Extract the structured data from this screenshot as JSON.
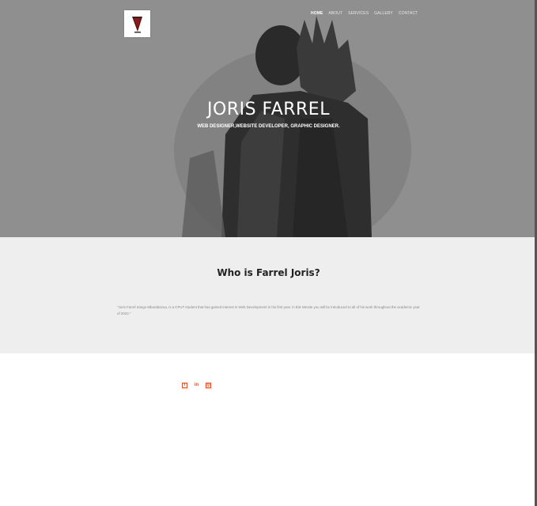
{
  "nav": {
    "items": [
      "HOME",
      "ABOUT",
      "SERVICES",
      "GALLERY",
      "CONTACT"
    ]
  },
  "hero": {
    "title": "JORIS FARREL",
    "subtitle": "WEB DESIGNER,WEBSITE DEVELOPER, GRAPHIC DESIGNER."
  },
  "about": {
    "heading": "Who is Farrel Joris?",
    "text": "\"Joris Farrel Irango Mbarabazua, is a CPUT student that has gained interest in Web Development in his first year. in this Wesite you will be introduced to all of his work throughout the academic year of 2022.\""
  },
  "social": {
    "icons": [
      "facebook-icon",
      "linkedin-icon",
      "instagram-icon"
    ]
  },
  "colors": {
    "accent": "#e44d26",
    "about_bg": "#eeeeee",
    "hero_bg": "#8c8c8c"
  }
}
